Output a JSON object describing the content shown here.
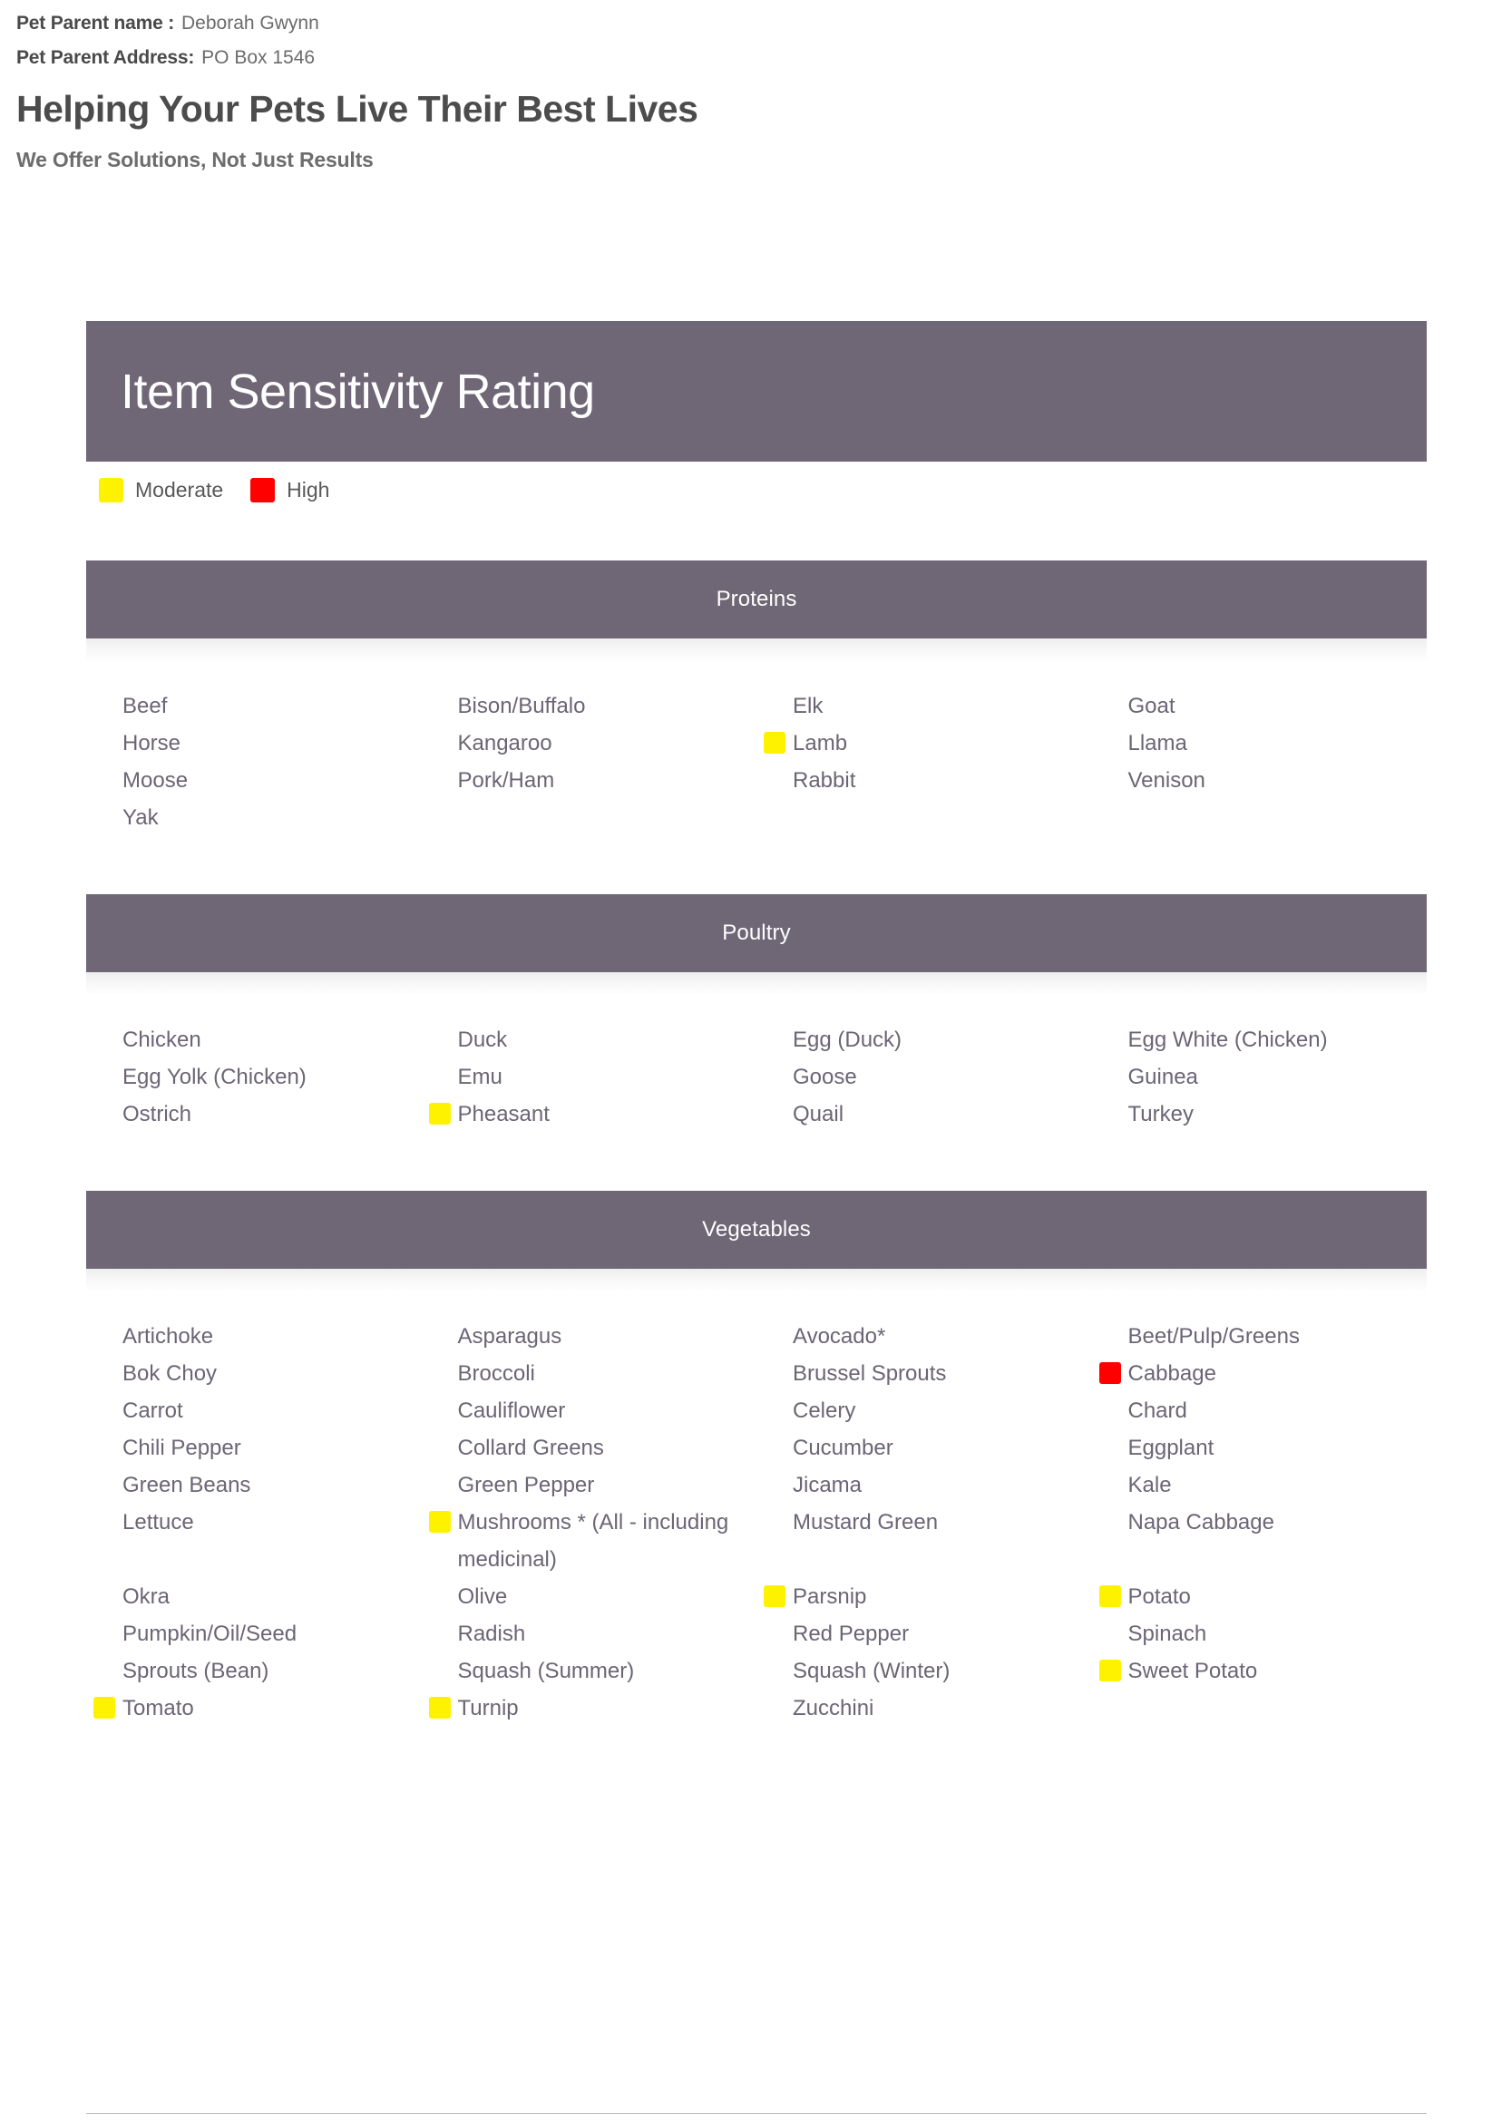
{
  "meta": {
    "parent_name_label": "Pet Parent name :",
    "parent_name_value": "Deborah Gwynn",
    "parent_address_label": "Pet Parent Address:",
    "parent_address_value": "PO Box 1546",
    "tagline_main": "Helping Your Pets Live Their Best Lives",
    "tagline_sub": "We Offer Solutions, Not Just Results"
  },
  "banner": {
    "title": "Item Sensitivity Rating"
  },
  "legend": {
    "items": [
      {
        "label": "Moderate",
        "color": "#fff200",
        "level": "moderate"
      },
      {
        "label": "High",
        "color": "#ff0000",
        "level": "high"
      }
    ]
  },
  "colors": {
    "banner_bg": "#6f6676",
    "item_text": "#6b6575",
    "moderate": "#fff200",
    "high": "#ff0000"
  },
  "sections": [
    {
      "title": "Proteins",
      "columns": [
        [
          {
            "label": "Beef",
            "level": "none"
          },
          {
            "label": "Horse",
            "level": "none"
          },
          {
            "label": "Moose",
            "level": "none"
          },
          {
            "label": "Yak",
            "level": "none"
          }
        ],
        [
          {
            "label": "Bison/Buffalo",
            "level": "none"
          },
          {
            "label": "Kangaroo",
            "level": "none"
          },
          {
            "label": "Pork/Ham",
            "level": "none"
          }
        ],
        [
          {
            "label": "Elk",
            "level": "none"
          },
          {
            "label": "Lamb",
            "level": "moderate"
          },
          {
            "label": "Rabbit",
            "level": "none"
          }
        ],
        [
          {
            "label": "Goat",
            "level": "none"
          },
          {
            "label": "Llama",
            "level": "none"
          },
          {
            "label": "Venison",
            "level": "none"
          }
        ]
      ]
    },
    {
      "title": "Poultry",
      "columns": [
        [
          {
            "label": "Chicken",
            "level": "none"
          },
          {
            "label": "Egg Yolk (Chicken)",
            "level": "none"
          },
          {
            "label": "Ostrich",
            "level": "none"
          }
        ],
        [
          {
            "label": "Duck",
            "level": "none"
          },
          {
            "label": "Emu",
            "level": "none"
          },
          {
            "label": "Pheasant",
            "level": "moderate"
          }
        ],
        [
          {
            "label": "Egg (Duck)",
            "level": "none"
          },
          {
            "label": "Goose",
            "level": "none"
          },
          {
            "label": "Quail",
            "level": "none"
          }
        ],
        [
          {
            "label": "Egg White (Chicken)",
            "level": "none"
          },
          {
            "label": "Guinea",
            "level": "none"
          },
          {
            "label": "Turkey",
            "level": "none"
          }
        ]
      ]
    },
    {
      "title": "Vegetables",
      "columns": [
        [
          {
            "label": "Artichoke",
            "level": "none"
          },
          {
            "label": "Bok Choy",
            "level": "none"
          },
          {
            "label": "Carrot",
            "level": "none"
          },
          {
            "label": "Chili Pepper",
            "level": "none"
          },
          {
            "label": "Green Beans",
            "level": "none"
          },
          {
            "label": "Lettuce",
            "level": "none"
          },
          {
            "label": "",
            "level": "none"
          },
          {
            "label": "Okra",
            "level": "none"
          },
          {
            "label": "Pumpkin/Oil/Seed",
            "level": "none"
          },
          {
            "label": "Sprouts (Bean)",
            "level": "none"
          },
          {
            "label": "Tomato",
            "level": "moderate"
          }
        ],
        [
          {
            "label": "Asparagus",
            "level": "none"
          },
          {
            "label": "Broccoli",
            "level": "none"
          },
          {
            "label": "Cauliflower",
            "level": "none"
          },
          {
            "label": "Collard Greens",
            "level": "none"
          },
          {
            "label": "Green Pepper",
            "level": "none"
          },
          {
            "label": "Mushrooms * (All - including medicinal)",
            "level": "moderate"
          },
          {
            "label": "Olive",
            "level": "none"
          },
          {
            "label": "Radish",
            "level": "none"
          },
          {
            "label": "Squash (Summer)",
            "level": "none"
          },
          {
            "label": "Turnip",
            "level": "moderate"
          }
        ],
        [
          {
            "label": "Avocado*",
            "level": "none"
          },
          {
            "label": "Brussel Sprouts",
            "level": "none"
          },
          {
            "label": "Celery",
            "level": "none"
          },
          {
            "label": "Cucumber",
            "level": "none"
          },
          {
            "label": "Jicama",
            "level": "none"
          },
          {
            "label": "Mustard Green",
            "level": "none"
          },
          {
            "label": "",
            "level": "none"
          },
          {
            "label": "Parsnip",
            "level": "moderate"
          },
          {
            "label": "Red Pepper",
            "level": "none"
          },
          {
            "label": "Squash (Winter)",
            "level": "none"
          },
          {
            "label": "Zucchini",
            "level": "none"
          }
        ],
        [
          {
            "label": "Beet/Pulp/Greens",
            "level": "none"
          },
          {
            "label": "Cabbage",
            "level": "high"
          },
          {
            "label": "Chard",
            "level": "none"
          },
          {
            "label": "Eggplant",
            "level": "none"
          },
          {
            "label": "Kale",
            "level": "none"
          },
          {
            "label": "Napa Cabbage",
            "level": "none"
          },
          {
            "label": "",
            "level": "none"
          },
          {
            "label": "Potato",
            "level": "moderate"
          },
          {
            "label": "Spinach",
            "level": "none"
          },
          {
            "label": "Sweet Potato",
            "level": "moderate"
          }
        ]
      ]
    }
  ]
}
